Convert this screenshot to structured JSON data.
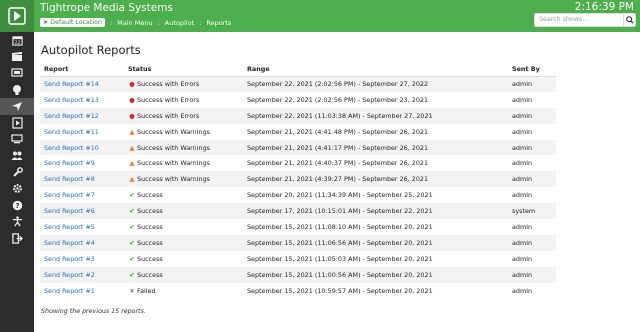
{
  "header": {
    "title": "Tightrope Media Systems",
    "clock": "2:16:39 PM",
    "location_label": "Default Location",
    "crumbs": [
      "Main Menu",
      "Autopilot",
      "Reports"
    ],
    "search_placeholder": "Search shows...",
    "brand_color": "#4cae4c"
  },
  "sidebar": {
    "icons": [
      "calendar-icon",
      "clapperboard-icon",
      "screen-icon",
      "lightbulb-icon",
      "send-icon",
      "media-icon",
      "monitor-icon",
      "people-icon",
      "wrench-icon",
      "gear-icon",
      "help-icon",
      "accessibility-icon",
      "signout-icon"
    ],
    "active": "send-icon"
  },
  "page": {
    "title": "Autopilot Reports",
    "columns": [
      "Report",
      "Status",
      "Range",
      "Sent By"
    ],
    "rows": [
      {
        "report": "Send Report #14",
        "status": "Success with Errors",
        "kind": "error",
        "range": "September 22, 2021 (2:02:56 PM) - September 27, 2022",
        "sent_by": "admin"
      },
      {
        "report": "Send Report #13",
        "status": "Success with Errors",
        "kind": "error",
        "range": "September 22, 2021 (2:02:56 PM) - September 23, 2021",
        "sent_by": "admin"
      },
      {
        "report": "Send Report #12",
        "status": "Success with Errors",
        "kind": "error",
        "range": "September 22, 2021 (11:03:38 AM) - September 27, 2021",
        "sent_by": "admin"
      },
      {
        "report": "Send Report #11",
        "status": "Success with Warnings",
        "kind": "warning",
        "range": "September 21, 2021 (4:41:48 PM) - September 26, 2021",
        "sent_by": "admin"
      },
      {
        "report": "Send Report #10",
        "status": "Success with Warnings",
        "kind": "warning",
        "range": "September 21, 2021 (4:41:17 PM) - September 26, 2021",
        "sent_by": "admin"
      },
      {
        "report": "Send Report #9",
        "status": "Success with Warnings",
        "kind": "warning",
        "range": "September 21, 2021 (4:40:37 PM) - September 26, 2021",
        "sent_by": "admin"
      },
      {
        "report": "Send Report #8",
        "status": "Success with Warnings",
        "kind": "warning",
        "range": "September 21, 2021 (4:39:27 PM) - September 26, 2021",
        "sent_by": "admin"
      },
      {
        "report": "Send Report #7",
        "status": "Success",
        "kind": "success",
        "range": "September 20, 2021 (11:34:39 AM) - September 25, 2021",
        "sent_by": "admin"
      },
      {
        "report": "Send Report #6",
        "status": "Success",
        "kind": "success",
        "range": "September 17, 2021 (10:15:01 AM) - September 22, 2021",
        "sent_by": "system"
      },
      {
        "report": "Send Report #5",
        "status": "Success",
        "kind": "success",
        "range": "September 15, 2021 (11:08:10 AM) - September 20, 2021",
        "sent_by": "admin"
      },
      {
        "report": "Send Report #4",
        "status": "Success",
        "kind": "success",
        "range": "September 15, 2021 (11:06:56 AM) - September 20, 2021",
        "sent_by": "admin"
      },
      {
        "report": "Send Report #3",
        "status": "Success",
        "kind": "success",
        "range": "September 15, 2021 (11:05:03 AM) - September 20, 2021",
        "sent_by": "admin"
      },
      {
        "report": "Send Report #2",
        "status": "Success",
        "kind": "success",
        "range": "September 15, 2021 (11:00:56 AM) - September 20, 2021",
        "sent_by": "admin"
      },
      {
        "report": "Send Report #1",
        "status": "Failed",
        "kind": "failed",
        "range": "September 15, 2021 (10:59:57 AM) - September 20, 2021",
        "sent_by": "admin"
      }
    ],
    "footnote": "Showing the previous 15 reports."
  },
  "status_icons": {
    "error": {
      "glyph": "●",
      "color": "#c9302c"
    },
    "warning": {
      "glyph": "▲",
      "color": "#e8801f"
    },
    "success": {
      "glyph": "✔",
      "color": "#3c9a3c"
    },
    "failed": {
      "glyph": "✕",
      "color": "#555555"
    }
  }
}
